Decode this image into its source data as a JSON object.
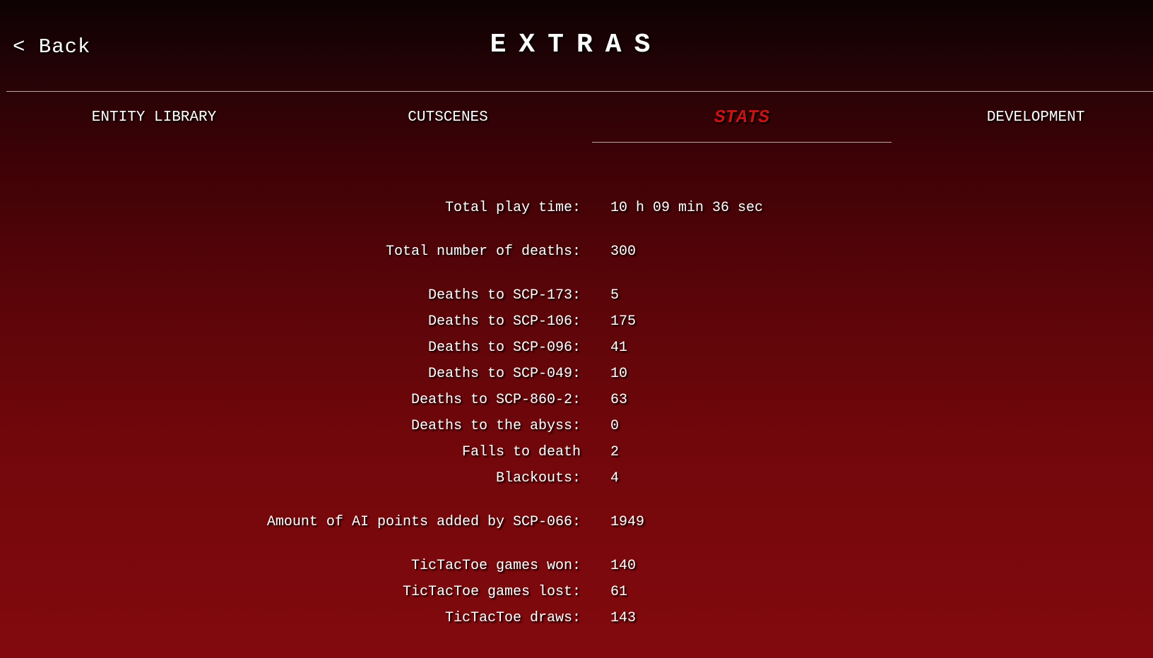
{
  "header": {
    "back_label": "< Back",
    "title": "EXTRAS"
  },
  "tabs": [
    {
      "label": "ENTITY LIBRARY",
      "active": false
    },
    {
      "label": "CUTSCENES",
      "active": false
    },
    {
      "label": "STATS",
      "active": true
    },
    {
      "label": "DEVELOPMENT",
      "active": false
    }
  ],
  "stats": [
    {
      "label": "Total play time:",
      "value": "10 h 09 min 36 sec"
    },
    {
      "label": "Total number of deaths:",
      "value": "300"
    },
    {
      "label": "Deaths to SCP-173:",
      "value": "5"
    },
    {
      "label": "Deaths to SCP-106:",
      "value": "175"
    },
    {
      "label": "Deaths to SCP-096:",
      "value": "41"
    },
    {
      "label": "Deaths to SCP-049:",
      "value": "10"
    },
    {
      "label": "Deaths to SCP-860-2:",
      "value": "63"
    },
    {
      "label": "Deaths to the abyss:",
      "value": "0"
    },
    {
      "label": "Falls to death",
      "value": "2"
    },
    {
      "label": "Blackouts:",
      "value": "4"
    },
    {
      "label": "Amount of AI points added by SCP-066:",
      "value": "1949"
    },
    {
      "label": "TicTacToe games won:",
      "value": "140"
    },
    {
      "label": "TicTacToe games lost:",
      "value": "61"
    },
    {
      "label": "TicTacToe draws:",
      "value": "143"
    }
  ],
  "colors": {
    "active_tab": "#c41414",
    "divider": "#b9a8a9"
  }
}
